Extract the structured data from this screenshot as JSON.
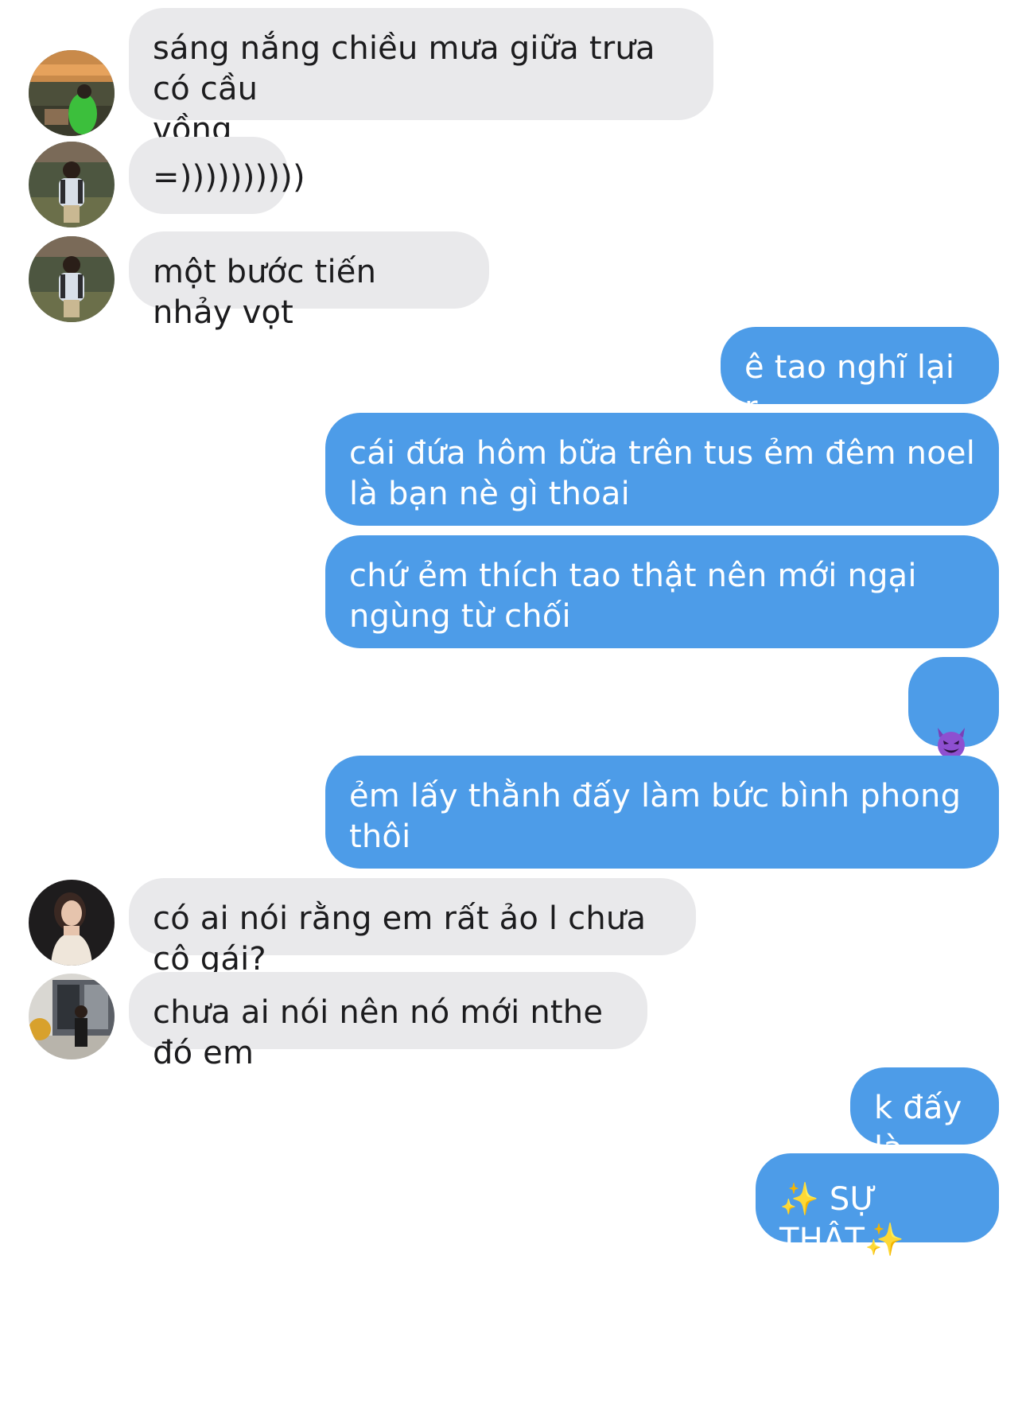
{
  "messages": [
    {
      "side": "in",
      "text": "sáng nắng chiều mưa giữa trưa có cầu\nvồng",
      "avatar": "avatar-sunset-green"
    },
    {
      "side": "in",
      "text": "=))))))))))",
      "avatar": "avatar-girl-striped-jacket"
    },
    {
      "side": "in",
      "text": "một bước tiến nhảy vọt",
      "avatar": "avatar-girl-striped-jacket"
    },
    {
      "side": "out",
      "text": "ê tao nghĩ lại r"
    },
    {
      "side": "out",
      "text": "cái đứa hôm bữa trên tus ẻm đêm noel\nlà bạn nè gì thoai"
    },
    {
      "side": "out",
      "text": "chứ ẻm thích tao thật nên mới ngại\nngùng từ chối"
    },
    {
      "side": "out",
      "text": "",
      "emoji": "smiling-devil-emoji"
    },
    {
      "side": "out",
      "text": "ẻm lấy thằnh đấy làm bức bình phong\nthôi"
    },
    {
      "side": "in",
      "text": "có ai nói rằng em rất ảo l chưa cô gái?",
      "avatar": "avatar-dark-portrait"
    },
    {
      "side": "in",
      "text": "chưa ai nói nên nó mới nthe đó em",
      "avatar": "avatar-storefront"
    },
    {
      "side": "out",
      "text": "k đấy là"
    },
    {
      "side": "out",
      "text": "✨ SỰ THẬT✨"
    }
  ],
  "colors": {
    "incoming_bubble": "#e9e9eb",
    "outgoing_bubble": "#4d9ce8",
    "incoming_text": "#1c1c1e",
    "outgoing_text": "#ffffff"
  }
}
